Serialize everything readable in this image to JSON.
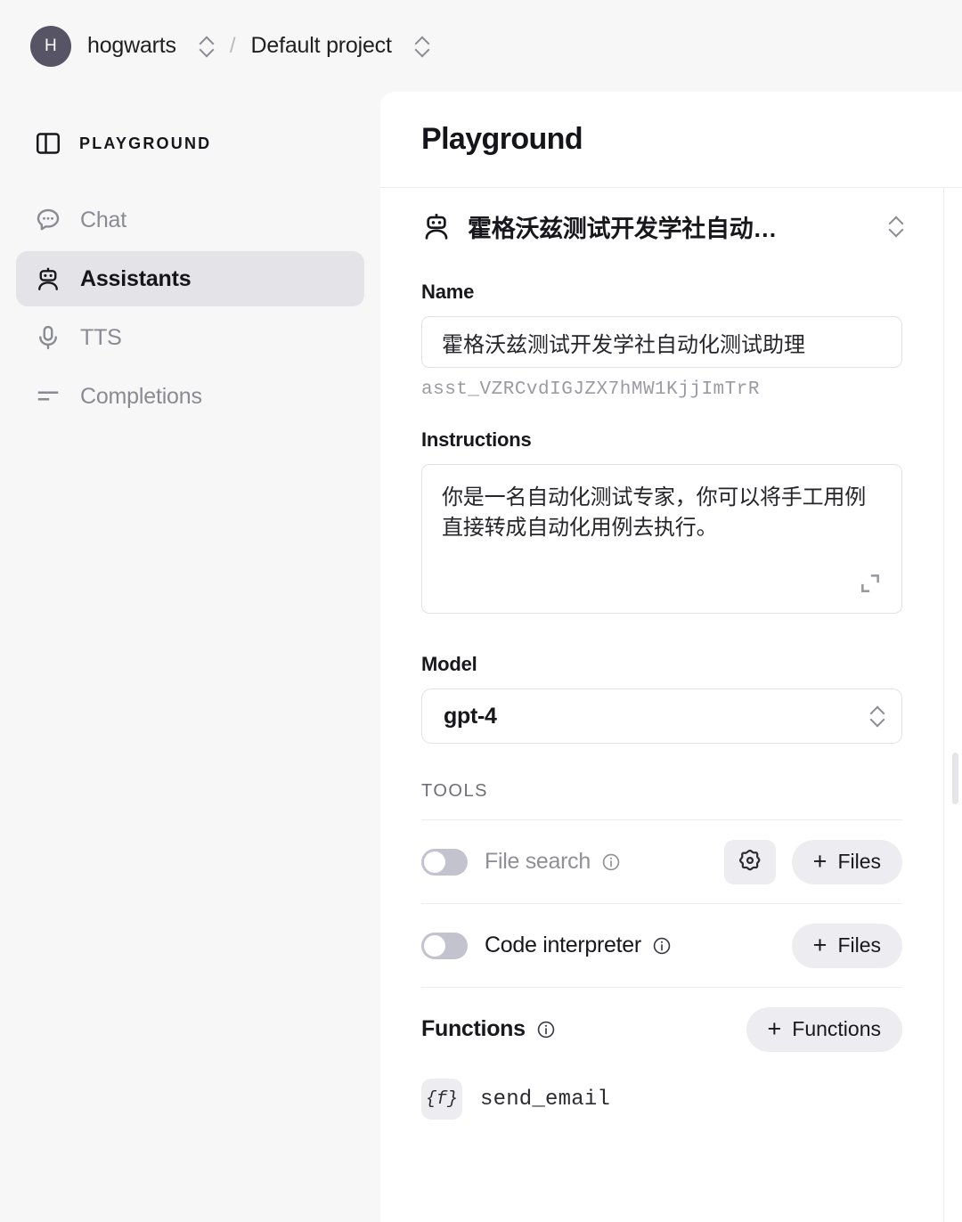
{
  "topbar": {
    "avatar_initial": "H",
    "org_name": "hogwarts",
    "separator": "/",
    "project_name": "Default project"
  },
  "sidebar": {
    "header_label": "PLAYGROUND",
    "items": [
      {
        "label": "Chat",
        "icon": "chat-bubble-icon",
        "active": false
      },
      {
        "label": "Assistants",
        "icon": "robot-icon",
        "active": true
      },
      {
        "label": "TTS",
        "icon": "microphone-icon",
        "active": false
      },
      {
        "label": "Completions",
        "icon": "lines-icon",
        "active": false
      }
    ]
  },
  "main": {
    "title": "Playground",
    "assistant_selector": {
      "name": "霍格沃兹测试开发学社自动…",
      "icon": "robot-icon"
    },
    "name_field": {
      "label": "Name",
      "value": "霍格沃兹测试开发学社自动化测试助理",
      "assistant_id": "asst_VZRCvdIGJZX7hMW1KjjImTrR"
    },
    "instructions_field": {
      "label": "Instructions",
      "value": "你是一名自动化测试专家，你可以将手工用例直接转成自动化用例去执行。",
      "expand_icon": "expand-icon"
    },
    "model_field": {
      "label": "Model",
      "value": "gpt-4"
    },
    "tools": {
      "section_label": "TOOLS",
      "rows": [
        {
          "name": "File search",
          "enabled": false,
          "info_icon": "info-icon",
          "settings_icon": "gear-icon",
          "settings_button": true,
          "add_button_label": "Files",
          "add_button_plus": "+"
        },
        {
          "name": "Code interpreter",
          "enabled": false,
          "info_icon": "info-icon",
          "settings_button": false,
          "add_button_label": "Files",
          "add_button_plus": "+"
        }
      ]
    },
    "functions": {
      "label": "Functions",
      "info_icon": "info-icon",
      "add_button_label": "Functions",
      "add_button_plus": "+",
      "items": [
        {
          "badge": "{f}",
          "name": "send_email"
        }
      ]
    }
  },
  "colors": {
    "page_background": "#f7f7f8",
    "panel_background": "#ffffff",
    "active_nav": "#e4e4e8",
    "avatar": "#565465",
    "muted_text": "#8a8a93",
    "button_grey": "#ededf1",
    "toggle_off": "#c3c3cf"
  }
}
